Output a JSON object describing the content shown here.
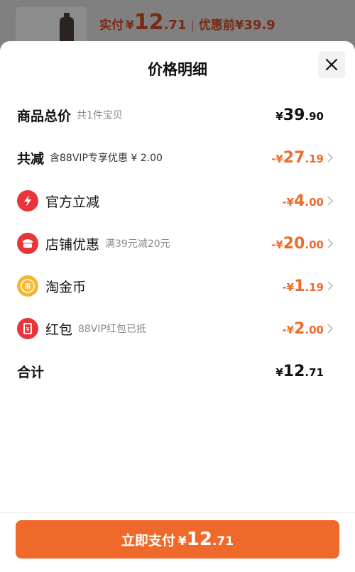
{
  "background": {
    "paid_label": "实付",
    "currency": "¥",
    "paid_int": "12",
    "paid_dec": ".71",
    "separator": "|",
    "original_label": "优惠前",
    "original_price": "¥39.9"
  },
  "sheet": {
    "title": "价格明细",
    "close_icon": "close-icon"
  },
  "rows": [
    {
      "name": "商品总价",
      "sub": "共1件宝贝",
      "cur": "¥",
      "int": "39",
      "dec": ".90"
    },
    {
      "name": "共减",
      "sub": "含88VIP专享优惠 ¥ 2.00",
      "cur": "-¥",
      "int": "27",
      "dec": ".19"
    },
    {
      "name": "官方立减",
      "sub": "",
      "cur": "-¥",
      "int": "4",
      "dec": ".00",
      "icon": "lightning-icon"
    },
    {
      "name": "店铺优惠",
      "sub": "满39元减20元",
      "cur": "-¥",
      "int": "20",
      "dec": ".00",
      "icon": "shop-icon"
    },
    {
      "name": "淘金币",
      "sub": "",
      "cur": "-¥",
      "int": "1",
      "dec": ".19",
      "icon": "coin-icon"
    },
    {
      "name": "红包",
      "sub": "88VIP红包已抵",
      "cur": "-¥",
      "int": "2",
      "dec": ".00",
      "icon": "red-packet-icon"
    },
    {
      "name": "合计",
      "sub": "",
      "cur": "¥",
      "int": "12",
      "dec": ".71"
    }
  ],
  "pay_button": {
    "label": "立即支付",
    "cur": "¥",
    "int": "12",
    "dec": ".71"
  },
  "colors": {
    "accent": "#ef6a2a",
    "discount": "#f06a2c",
    "red_icon": "#e8353a",
    "coin": "#f5b731"
  }
}
